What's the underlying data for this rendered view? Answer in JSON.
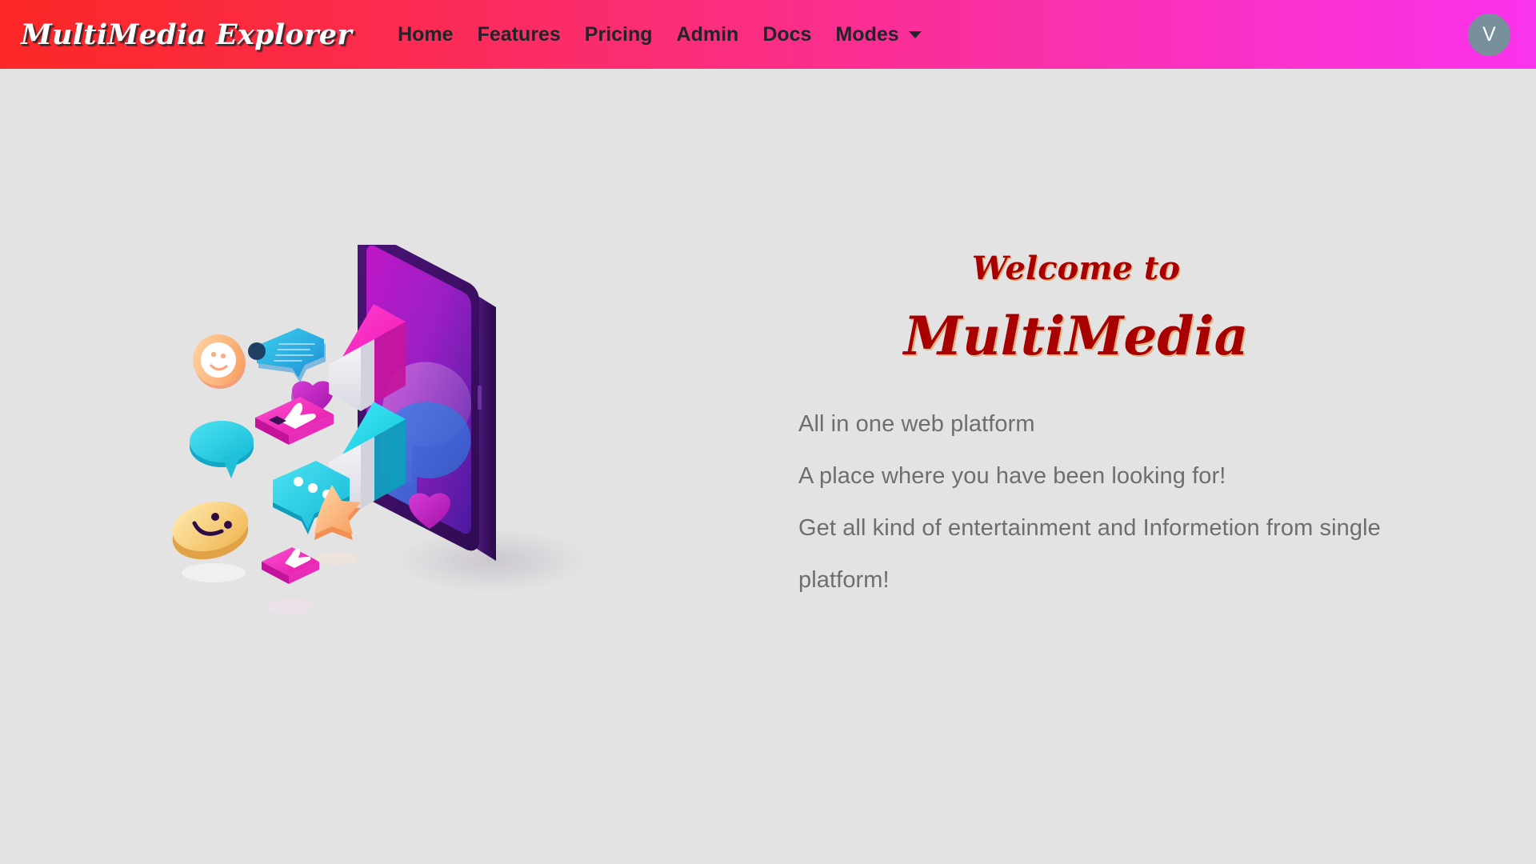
{
  "navbar": {
    "brand": "MultiMedia Explorer",
    "links": [
      {
        "label": "Home"
      },
      {
        "label": "Features"
      },
      {
        "label": "Pricing"
      },
      {
        "label": "Admin"
      },
      {
        "label": "Docs"
      }
    ],
    "dropdown": {
      "label": "Modes",
      "caret_icon": "chevron-down-icon"
    },
    "avatar": {
      "initial": "V",
      "bg_color": "#78909c",
      "text_color": "#ffffff"
    },
    "gradient_start": "#fb2727",
    "gradient_end": "#fa33ee"
  },
  "hero": {
    "eyebrow": "Welcome to",
    "title": "MultiMedia",
    "title_color": "#a80000",
    "paragraphs": [
      "All in one web platform",
      "A place where you have been looking for!",
      "Get all kind of entertainment and Informetion from single platform!"
    ],
    "paragraph_color": "#6e6e6e",
    "background_color": "#e3e3e3",
    "illustration": {
      "name": "isometric-phone-social-icons-illustration",
      "alt": "Isometric purple smartphone with floating 3D social media reaction icons",
      "phone_color": "#5b1f8f",
      "accent_colors": [
        "#ff2fbd",
        "#27d9e8",
        "#f7a83c",
        "#c026c0"
      ]
    }
  }
}
